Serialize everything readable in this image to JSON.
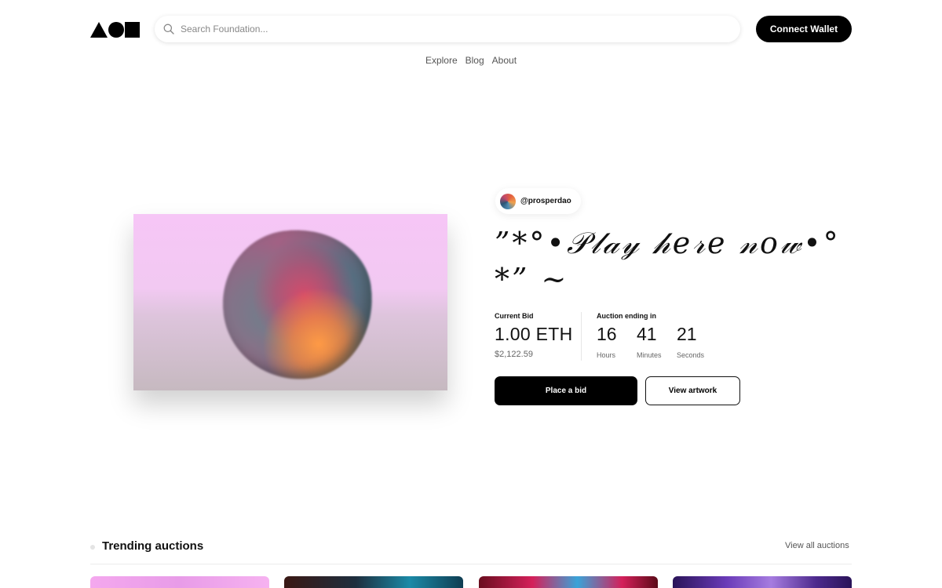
{
  "header": {
    "search_placeholder": "Search Foundation...",
    "connect_label": "Connect Wallet",
    "nav": [
      "Explore",
      "Blog",
      "About"
    ]
  },
  "hero": {
    "creator": "@prosperdao",
    "title": "”*°•𝒫𝓁𝒶𝓎 𝒽𝑒𝓇𝑒 𝓃𝑜𝓌•°*” ~",
    "current_bid_label": "Current Bid",
    "bid_amount": "1.00 ETH",
    "bid_usd": "$2,122.59",
    "auction_label": "Auction ending in",
    "countdown": [
      {
        "value": "16",
        "unit": "Hours"
      },
      {
        "value": "41",
        "unit": "Minutes"
      },
      {
        "value": "21",
        "unit": "Seconds"
      }
    ],
    "place_bid_label": "Place a bid",
    "view_artwork_label": "View artwork"
  },
  "trending": {
    "title": "Trending auctions",
    "view_all_label": "View all auctions"
  },
  "colors": {
    "primary": "#000000",
    "background": "#ffffff",
    "muted_text": "#666666"
  }
}
